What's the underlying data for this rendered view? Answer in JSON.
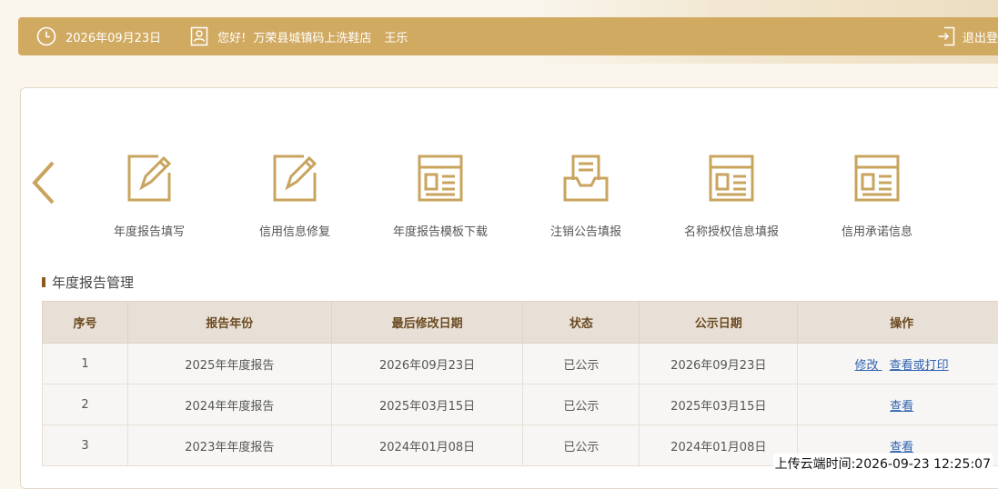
{
  "header": {
    "date": "2026年09月23日",
    "greeting": "您好!",
    "company": "万荣县城镇码上洗鞋店",
    "user": "王乐",
    "logout_label": "退出登"
  },
  "functions": [
    {
      "label": "年度报告填写",
      "icon": "edit-icon"
    },
    {
      "label": "信用信息修复",
      "icon": "edit-icon"
    },
    {
      "label": "年度报告模板下载",
      "icon": "document-icon"
    },
    {
      "label": "注销公告填报",
      "icon": "inbox-icon"
    },
    {
      "label": "名称授权信息填报",
      "icon": "document-icon"
    },
    {
      "label": "信用承诺信息",
      "icon": "document-icon"
    }
  ],
  "section": {
    "title": "年度报告管理"
  },
  "table": {
    "headers": [
      "序号",
      "报告年份",
      "最后修改日期",
      "状态",
      "公示日期",
      "操作"
    ],
    "rows": [
      {
        "index": "1",
        "year": "2025年年度报告",
        "modified": "2026年09月23日",
        "status": "已公示",
        "published": "2026年09月23日",
        "actions": [
          "修改 ",
          "查看或打印"
        ]
      },
      {
        "index": "2",
        "year": "2024年年度报告",
        "modified": "2025年03月15日",
        "status": "已公示",
        "published": "2025年03月15日",
        "actions": [
          "查看"
        ]
      },
      {
        "index": "3",
        "year": "2023年年度报告",
        "modified": "2024年01月08日",
        "status": "已公示",
        "published": "2024年01月08日",
        "actions": [
          "查看"
        ]
      }
    ]
  },
  "footer": {
    "upload_time": "上传云端时间:2026-09-23 12:25:07"
  },
  "colors": {
    "accent": "#d1aa62",
    "header_bg": "#e8e0d6",
    "link": "#2f62b0"
  }
}
